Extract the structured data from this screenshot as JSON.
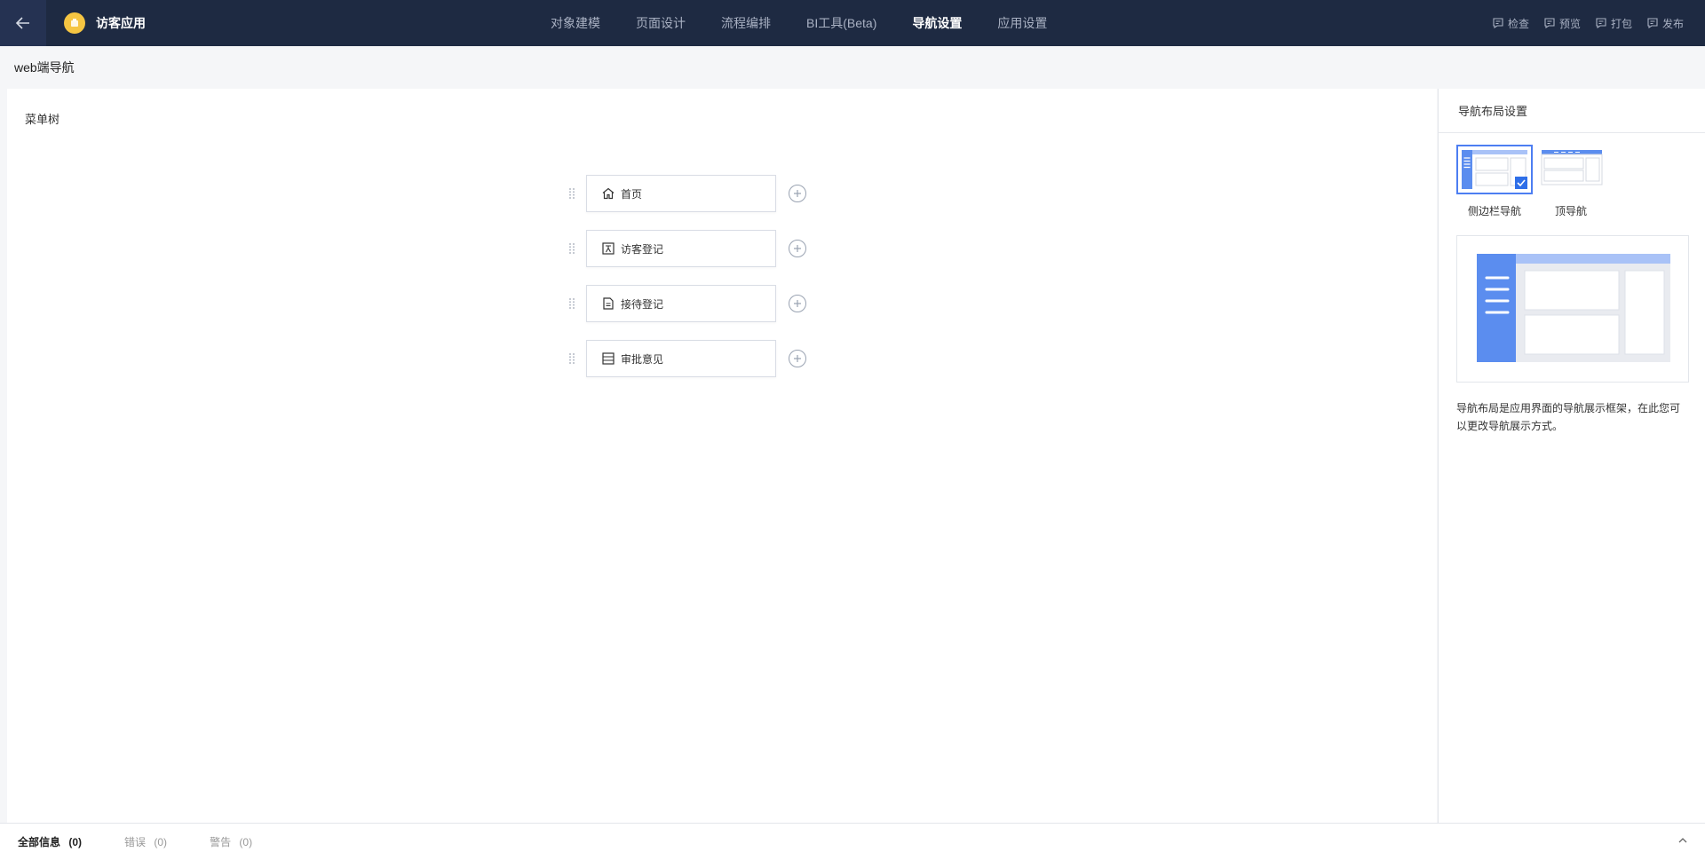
{
  "app": {
    "name": "访客应用"
  },
  "nav": {
    "tabs": [
      {
        "label": "对象建模"
      },
      {
        "label": "页面设计"
      },
      {
        "label": "流程编排"
      },
      {
        "label": "BI工具(Beta)"
      },
      {
        "label": "导航设置",
        "active": true
      },
      {
        "label": "应用设置"
      }
    ]
  },
  "actions": [
    {
      "label": "检查",
      "icon": "check-icon"
    },
    {
      "label": "预览",
      "icon": "preview-icon"
    },
    {
      "label": "打包",
      "icon": "package-icon"
    },
    {
      "label": "发布",
      "icon": "publish-icon"
    }
  ],
  "subheader": {
    "title": "web端导航"
  },
  "canvas": {
    "title": "菜单树",
    "menu_items": [
      {
        "label": "首页",
        "icon": "home-icon"
      },
      {
        "label": "访客登记",
        "icon": "form-icon"
      },
      {
        "label": "接待登记",
        "icon": "document-icon"
      },
      {
        "label": "审批意见",
        "icon": "list-icon"
      }
    ]
  },
  "layout_panel": {
    "title": "导航布局设置",
    "options": [
      {
        "label": "侧边栏导航",
        "selected": true
      },
      {
        "label": "顶导航",
        "selected": false
      }
    ],
    "description": "导航布局是应用界面的导航展示框架，在此您可以更改导航展示方式。"
  },
  "bottom": {
    "tabs": [
      {
        "label": "全部信息",
        "count": "(0)",
        "active": true
      },
      {
        "label": "错误",
        "count": "(0)"
      },
      {
        "label": "警告",
        "count": "(0)"
      }
    ]
  },
  "colors": {
    "topbar": "#1e2a42",
    "accent": "#4d7ef2"
  }
}
